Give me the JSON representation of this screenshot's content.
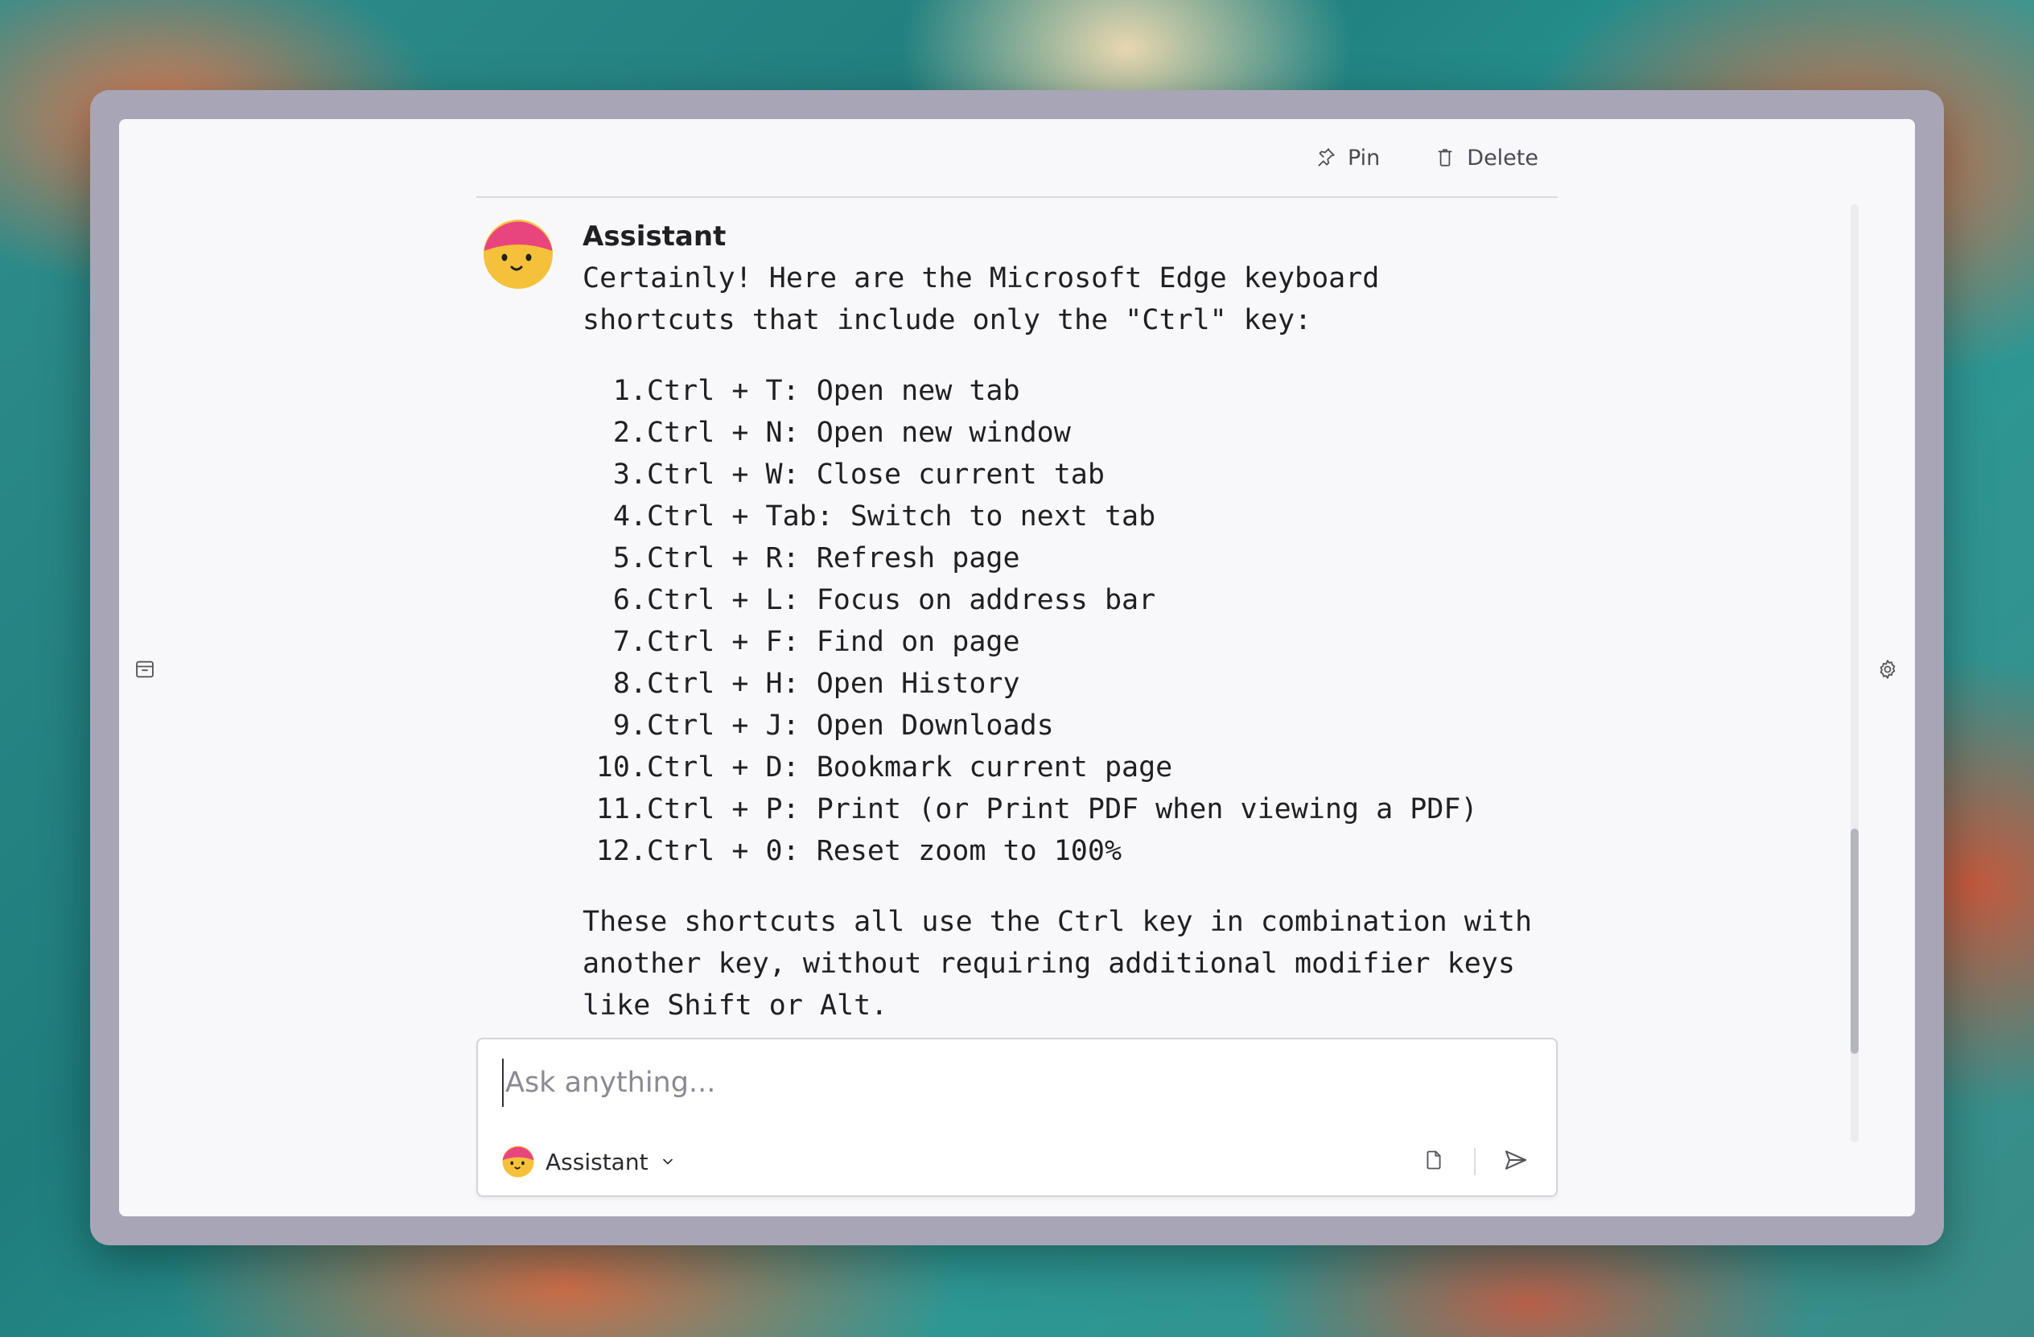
{
  "header": {
    "pin_label": "Pin",
    "delete_label": "Delete"
  },
  "message": {
    "sender": "Assistant",
    "intro": "Certainly! Here are the Microsoft Edge keyboard shortcuts that include only the \"Ctrl\" key:",
    "shortcuts": [
      {
        "num": "1.",
        "text": "Ctrl + T: Open new tab"
      },
      {
        "num": "2.",
        "text": "Ctrl + N: Open new window"
      },
      {
        "num": "3.",
        "text": "Ctrl + W: Close current tab"
      },
      {
        "num": "4.",
        "text": "Ctrl + Tab: Switch to next tab"
      },
      {
        "num": "5.",
        "text": "Ctrl + R: Refresh page"
      },
      {
        "num": "6.",
        "text": "Ctrl + L: Focus on address bar"
      },
      {
        "num": "7.",
        "text": "Ctrl + F: Find on page"
      },
      {
        "num": "8.",
        "text": "Ctrl + H: Open History"
      },
      {
        "num": "9.",
        "text": "Ctrl + J: Open Downloads"
      },
      {
        "num": "10.",
        "text": "Ctrl + D: Bookmark current page"
      },
      {
        "num": "11.",
        "text": "Ctrl + P: Print (or Print PDF when viewing a PDF)"
      },
      {
        "num": "12.",
        "text": "Ctrl + 0: Reset zoom to 100%"
      }
    ],
    "outro": "These shortcuts all use the Ctrl key in combination with another key, without requiring additional modifier keys like Shift or Alt."
  },
  "composer": {
    "placeholder": "Ask anything...",
    "value": "",
    "model_label": "Assistant"
  },
  "icons": {
    "left": "archive-icon",
    "right": "gear-icon",
    "pin": "pin-icon",
    "delete": "trash-icon",
    "attach": "file-icon",
    "send": "send-icon",
    "chevron": "chevron-down-icon"
  },
  "colors": {
    "avatar_hat": "#e8457e",
    "avatar_face": "#f6c13a",
    "panel_bg": "#f8f8fb",
    "window_frame": "#a8a6b6"
  }
}
